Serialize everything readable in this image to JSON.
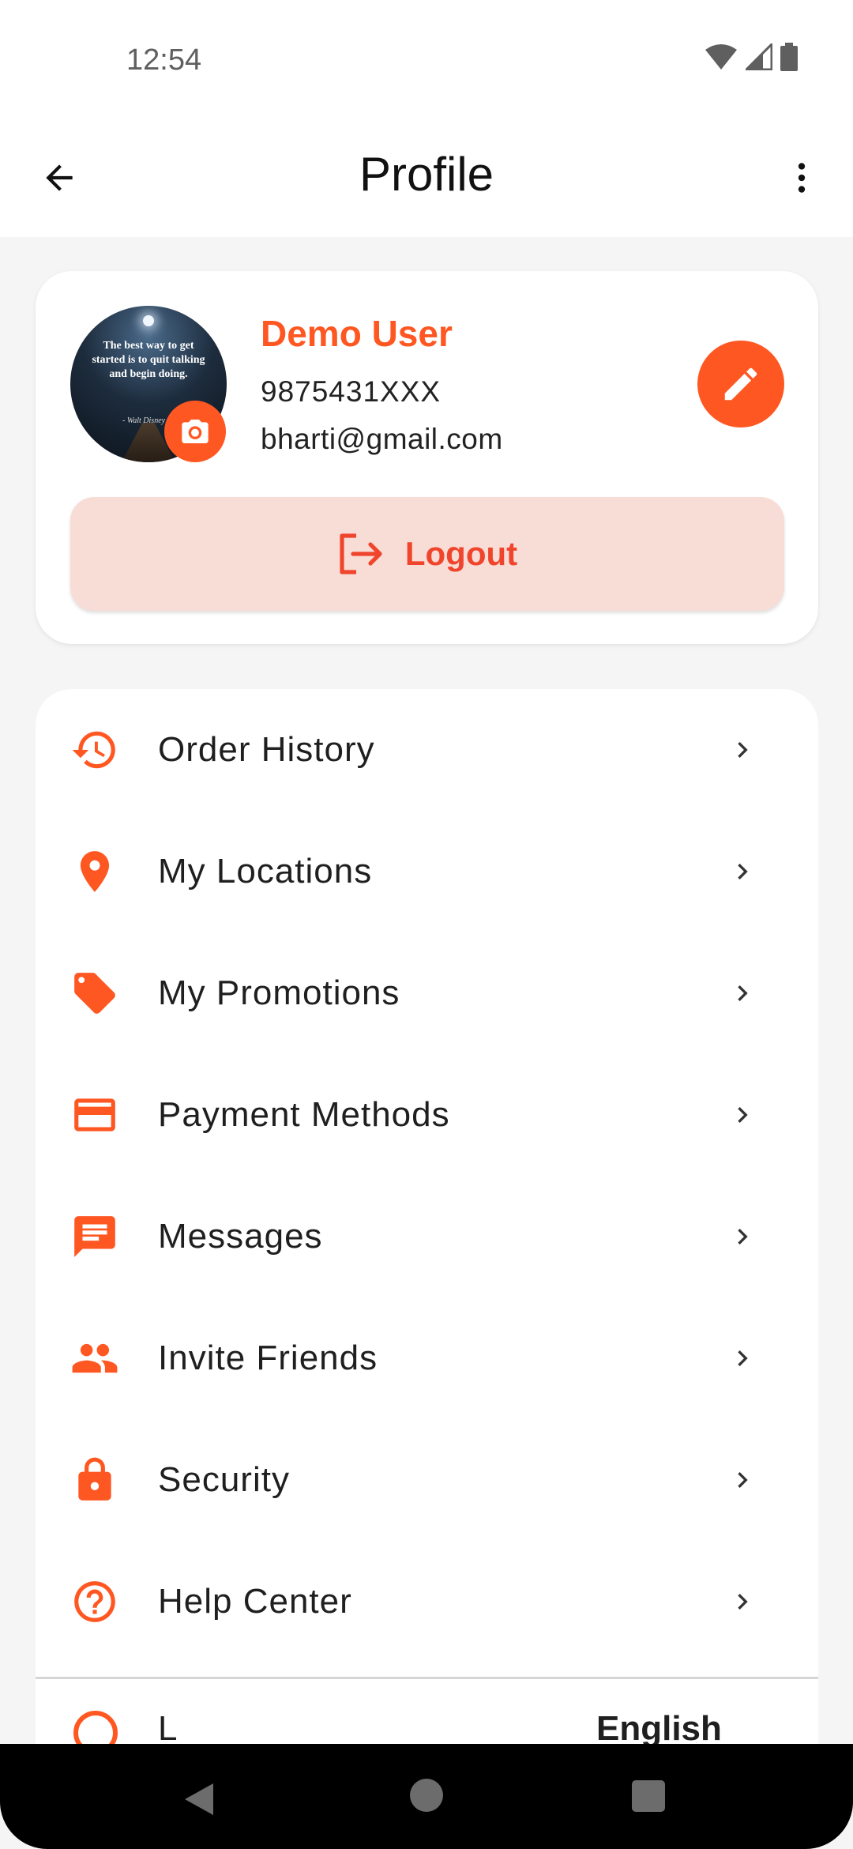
{
  "status_bar": {
    "time": "12:54"
  },
  "app_bar": {
    "title": "Profile"
  },
  "profile": {
    "name": "Demo User",
    "phone": "9875431XXX",
    "email": "bharti@gmail.com",
    "avatar_quote": "The best way to get started is to quit talking and begin doing.",
    "avatar_attribution": "- Walt Disney",
    "logout_label": "Logout"
  },
  "menu": {
    "items": [
      {
        "label": "Order History",
        "icon": "history-icon"
      },
      {
        "label": "My Locations",
        "icon": "location-pin-icon"
      },
      {
        "label": "My Promotions",
        "icon": "tag-icon"
      },
      {
        "label": "Payment Methods",
        "icon": "credit-card-icon"
      },
      {
        "label": "Messages",
        "icon": "message-icon"
      },
      {
        "label": "Invite Friends",
        "icon": "people-icon"
      },
      {
        "label": "Security",
        "icon": "lock-icon"
      },
      {
        "label": "Help Center",
        "icon": "help-circle-icon"
      }
    ],
    "partial_item": {
      "label": "L",
      "value": "English",
      "icon": "globe-icon"
    }
  },
  "colors": {
    "accent": "#ff5722",
    "logout_bg": "#f8ddd6",
    "logout_text": "#f0452d",
    "background": "#f5f5f5"
  }
}
